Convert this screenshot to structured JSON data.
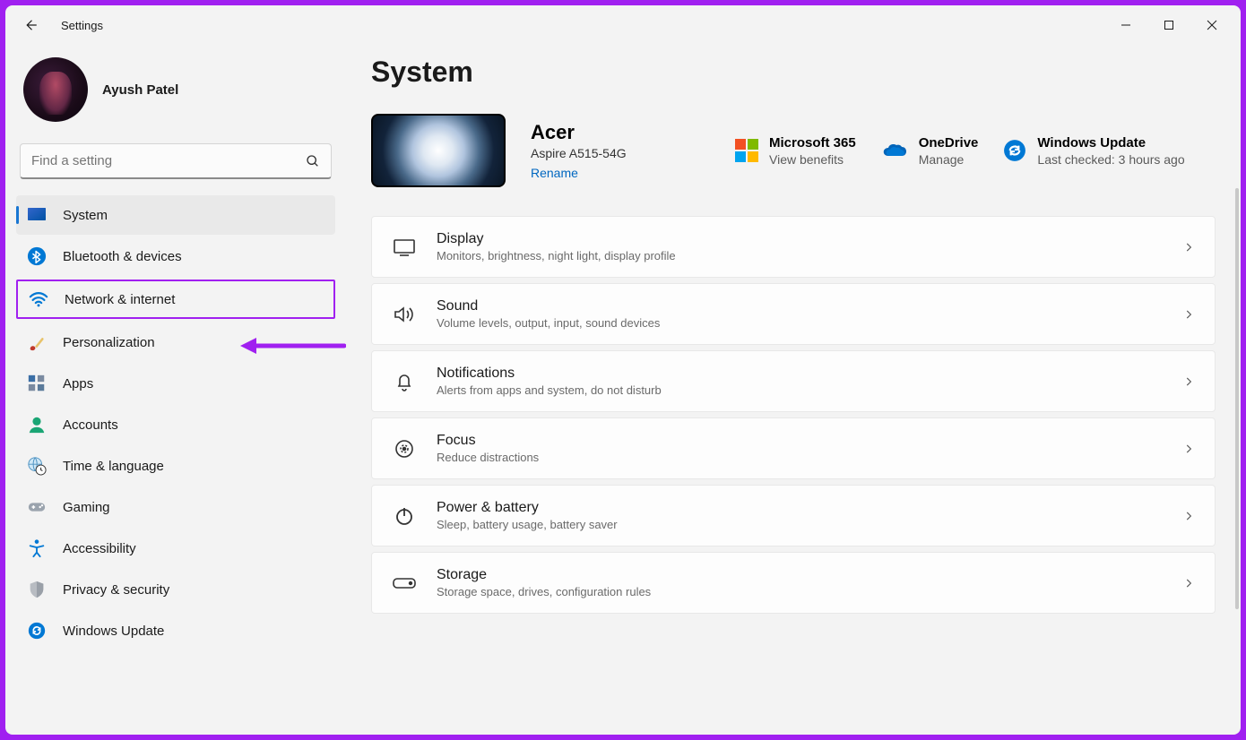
{
  "app_title": "Settings",
  "user": {
    "name": "Ayush Patel"
  },
  "search": {
    "placeholder": "Find a setting"
  },
  "sidebar": {
    "items": [
      {
        "label": "System",
        "icon": "system-icon"
      },
      {
        "label": "Bluetooth & devices",
        "icon": "bluetooth-icon"
      },
      {
        "label": "Network & internet",
        "icon": "wifi-icon"
      },
      {
        "label": "Personalization",
        "icon": "paintbrush-icon"
      },
      {
        "label": "Apps",
        "icon": "apps-icon"
      },
      {
        "label": "Accounts",
        "icon": "person-icon"
      },
      {
        "label": "Time & language",
        "icon": "clock-globe-icon"
      },
      {
        "label": "Gaming",
        "icon": "gamepad-icon"
      },
      {
        "label": "Accessibility",
        "icon": "accessibility-icon"
      },
      {
        "label": "Privacy & security",
        "icon": "shield-icon"
      },
      {
        "label": "Windows Update",
        "icon": "update-icon"
      }
    ],
    "selected_index": 0,
    "highlighted_index": 2
  },
  "page": {
    "title": "System",
    "device": {
      "name": "Acer",
      "model": "Aspire A515-54G",
      "rename": "Rename"
    },
    "info_blocks": [
      {
        "title": "Microsoft 365",
        "sub": "View benefits",
        "icon": "microsoft-logo-icon"
      },
      {
        "title": "OneDrive",
        "sub": "Manage",
        "icon": "onedrive-icon"
      },
      {
        "title": "Windows Update",
        "sub": "Last checked: 3 hours ago",
        "icon": "update-icon"
      }
    ],
    "cards": [
      {
        "title": "Display",
        "sub": "Monitors, brightness, night light, display profile",
        "icon": "display-icon"
      },
      {
        "title": "Sound",
        "sub": "Volume levels, output, input, sound devices",
        "icon": "sound-icon"
      },
      {
        "title": "Notifications",
        "sub": "Alerts from apps and system, do not disturb",
        "icon": "bell-icon"
      },
      {
        "title": "Focus",
        "sub": "Reduce distractions",
        "icon": "focus-icon"
      },
      {
        "title": "Power & battery",
        "sub": "Sleep, battery usage, battery saver",
        "icon": "power-icon"
      },
      {
        "title": "Storage",
        "sub": "Storage space, drives, configuration rules",
        "icon": "storage-icon"
      }
    ]
  }
}
